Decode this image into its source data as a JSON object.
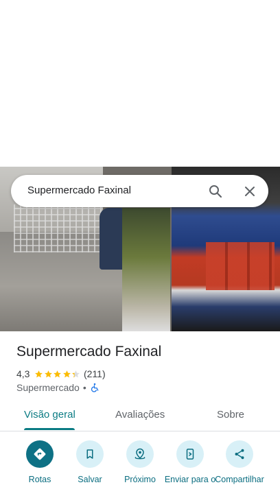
{
  "search": {
    "query": "Supermercado Faxinal"
  },
  "place": {
    "name": "Supermercado Faxinal",
    "rating": "4,3",
    "rating_value": 4.3,
    "review_count": "(211)",
    "category": "Supermercado",
    "separator": "•"
  },
  "tabs": [
    {
      "label": "Visão geral",
      "active": true
    },
    {
      "label": "Avaliações",
      "active": false
    },
    {
      "label": "Sobre",
      "active": false
    }
  ],
  "actions": [
    {
      "label": "Rotas",
      "icon": "directions-icon"
    },
    {
      "label": "Salvar",
      "icon": "bookmark-icon"
    },
    {
      "label": "Próximo",
      "icon": "nearby-icon"
    },
    {
      "label": "Enviar para o",
      "icon": "send-to-phone-icon"
    },
    {
      "label": "Compartilhar",
      "icon": "share-icon"
    }
  ],
  "colors": {
    "accent": "#0a7b83",
    "primary_button": "#0e7185",
    "button_tint": "#d8f0f7",
    "star": "#fbbc04"
  }
}
